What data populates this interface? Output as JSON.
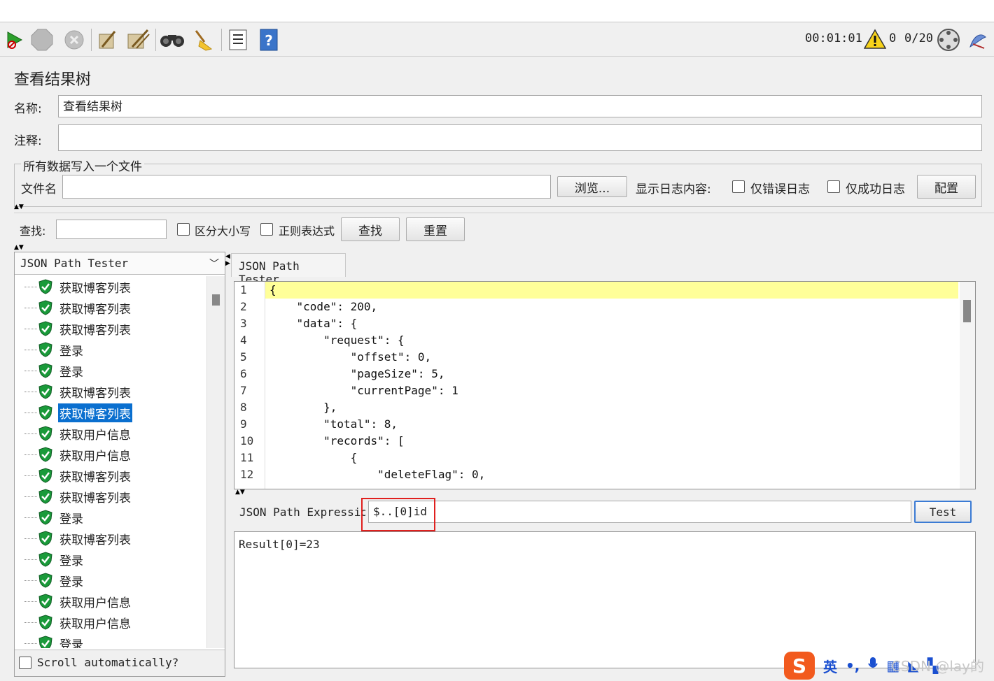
{
  "toolbar": {
    "timer": "00:01:01",
    "warnings": "0",
    "threads": "0/20",
    "buttons": [
      "start-icon",
      "stop-icon",
      "shutdown-icon",
      "clear-icon",
      "clear-all-icon",
      "search-icon",
      "reset-search-icon",
      "function-helper-icon",
      "help-icon"
    ]
  },
  "panel": {
    "title": "查看结果树",
    "name_label": "名称:",
    "name_value": "查看结果树",
    "comment_label": "注释:",
    "comment_value": "",
    "file_group": "所有数据写入一个文件",
    "file_label": "文件名",
    "file_value": "",
    "browse": "浏览...",
    "log_label": "显示日志内容:",
    "errors_only": "仅错误日志",
    "success_only": "仅成功日志",
    "config": "配置"
  },
  "search": {
    "label": "查找:",
    "value": "",
    "case_sensitive": "区分大小写",
    "regex": "正则表达式",
    "find": "查找",
    "reset": "重置"
  },
  "renderer": {
    "selected": "JSON Path Tester",
    "tab": "JSON Path Tester"
  },
  "tree": {
    "items": [
      {
        "label": "获取博客列表"
      },
      {
        "label": "获取博客列表"
      },
      {
        "label": "获取博客列表"
      },
      {
        "label": "登录"
      },
      {
        "label": "登录"
      },
      {
        "label": "获取博客列表"
      },
      {
        "label": "获取博客列表",
        "selected": true
      },
      {
        "label": "获取用户信息"
      },
      {
        "label": "获取用户信息"
      },
      {
        "label": "获取博客列表"
      },
      {
        "label": "获取博客列表"
      },
      {
        "label": "登录"
      },
      {
        "label": "获取博客列表"
      },
      {
        "label": "登录"
      },
      {
        "label": "登录"
      },
      {
        "label": "获取用户信息"
      },
      {
        "label": "获取用户信息"
      },
      {
        "label": "登录"
      }
    ],
    "scroll_auto": "Scroll automatically?"
  },
  "editor": {
    "lines": [
      "{",
      "    \"code\": 200,",
      "    \"data\": {",
      "        \"request\": {",
      "            \"offset\": 0,",
      "            \"pageSize\": 5,",
      "            \"currentPage\": 1",
      "        },",
      "        \"total\": 8,",
      "        \"records\": [",
      "            {",
      "                \"deleteFlag\": 0,"
    ]
  },
  "json_path": {
    "label": "JSON Path Expression",
    "value": "$..[0]id",
    "test": "Test",
    "result": "Result[0]=23"
  },
  "ime": {
    "logo": "S",
    "lang": "英",
    "watermark": "CSDN @lay的"
  },
  "colors": {
    "selection": "#0a6fcf",
    "highlight_line": "#ffff99",
    "annotation": "#e0201e",
    "shield_green": "#1a9a3a"
  }
}
